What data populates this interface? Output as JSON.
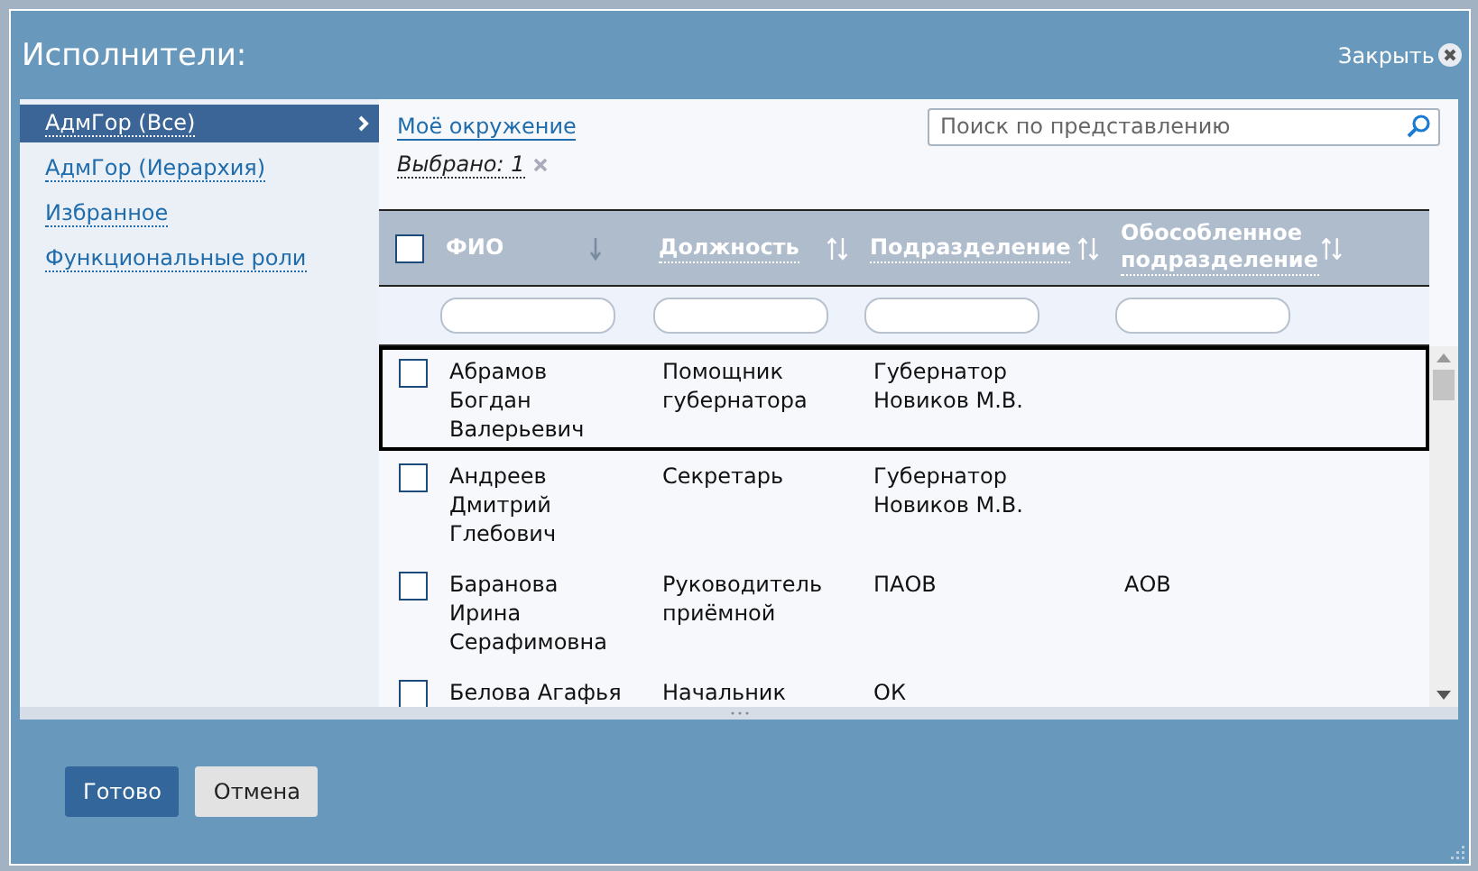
{
  "dialog": {
    "title": "Исполнители:",
    "close_label": "Закрыть"
  },
  "sidebar": {
    "items": [
      {
        "label": "АдмГор (Все)",
        "selected": true
      },
      {
        "label": "АдмГор (Иерархия)",
        "selected": false
      },
      {
        "label": "Избранное",
        "selected": false
      },
      {
        "label": "Функциональные роли",
        "selected": false
      }
    ]
  },
  "toolbar": {
    "link": "Моё окружение",
    "search": {
      "placeholder": "Поиск по представлению"
    },
    "selected_count": "Выбрано: 1"
  },
  "table": {
    "all_checked": false,
    "columns": [
      {
        "label": "ФИО",
        "sorted": true
      },
      {
        "label": "Должность",
        "sorted": false
      },
      {
        "label": "Подразделение",
        "sorted": false
      },
      {
        "label": "Обособленное подразделение",
        "sorted": false
      }
    ],
    "rows": [
      {
        "checked": false,
        "focused": true,
        "cells": [
          "Абрамов Богдан Валерьевич",
          "Помощник губернатора",
          "Губернатор Новиков М.В.",
          ""
        ]
      },
      {
        "checked": false,
        "focused": false,
        "cells": [
          "Андреев Дмитрий Глебович",
          "Секретарь",
          "Губернатор Новиков М.В.",
          ""
        ]
      },
      {
        "checked": false,
        "focused": false,
        "cells": [
          "Баранова Ирина Серафимовна",
          "Руководитель приёмной",
          "ПАОВ",
          "АОВ"
        ]
      },
      {
        "checked": false,
        "focused": false,
        "cells": [
          "Белова Агафья",
          "Начальник",
          "ОК",
          ""
        ]
      }
    ]
  },
  "buttons": [
    {
      "label": "Готово",
      "kind": "primary"
    },
    {
      "label": "Отмена",
      "kind": "secondary"
    }
  ]
}
